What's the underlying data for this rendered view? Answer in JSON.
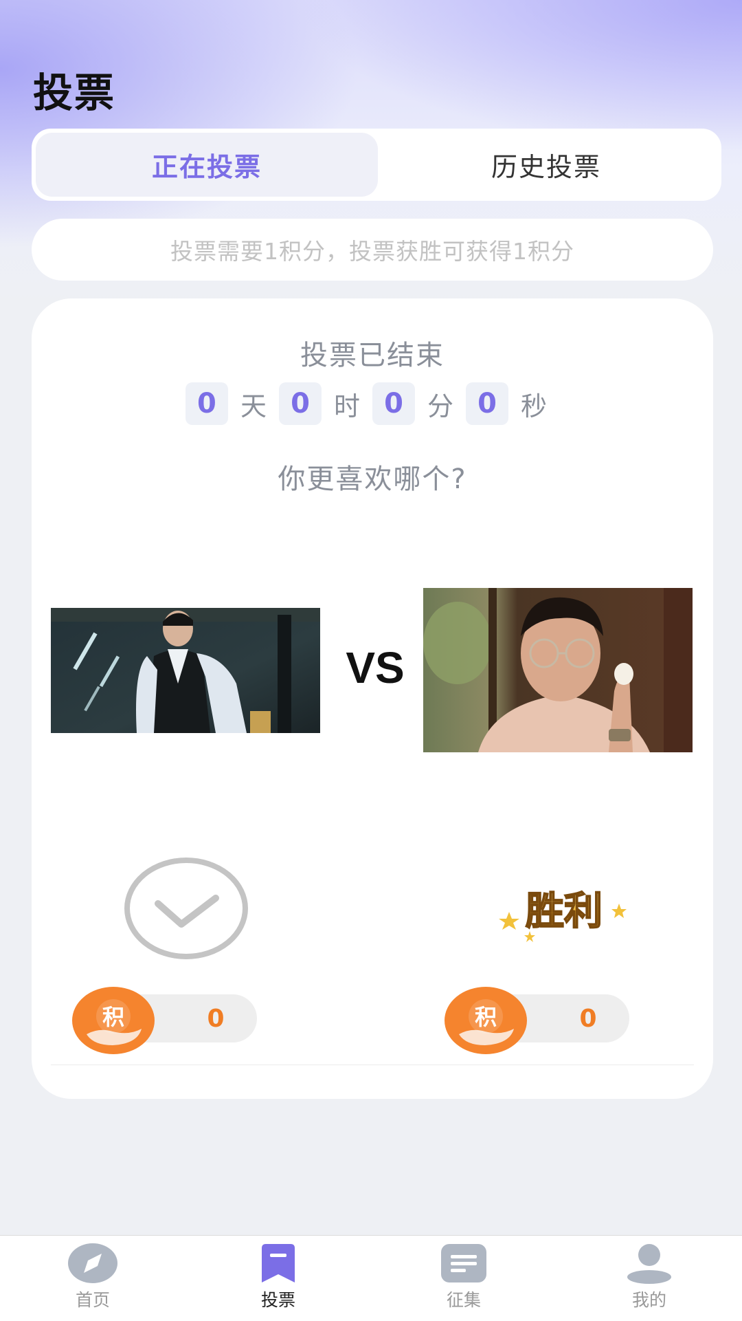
{
  "header": {
    "title": "投票"
  },
  "tabs": [
    {
      "label": "正在投票",
      "active": true
    },
    {
      "label": "历史投票",
      "active": false
    }
  ],
  "notice": "投票需要1积分，投票获胜可获得1积分",
  "vote": {
    "status": "投票已结束",
    "countdown": {
      "days": "0",
      "days_unit": "天",
      "hours": "0",
      "hours_unit": "时",
      "minutes": "0",
      "minutes_unit": "分",
      "seconds": "0",
      "seconds_unit": "秒"
    },
    "question": "你更喜欢哪个?",
    "vs_label": "VS",
    "left": {
      "points": "0",
      "coin_char": "积"
    },
    "right": {
      "points": "0",
      "coin_char": "积",
      "badge_text": "胜利"
    }
  },
  "tabbar": [
    {
      "label": "首页",
      "icon": "compass-icon"
    },
    {
      "label": "投票",
      "icon": "vote-icon",
      "active": true
    },
    {
      "label": "征集",
      "icon": "document-icon"
    },
    {
      "label": "我的",
      "icon": "profile-icon"
    }
  ],
  "colors": {
    "accent": "#7b6ee6",
    "points_orange": "#f07d24",
    "muted_text": "#8a8f99"
  }
}
